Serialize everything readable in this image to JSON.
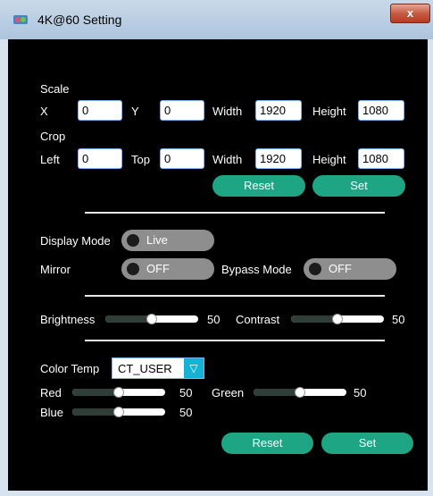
{
  "window": {
    "title": "4K@60 Setting",
    "close_label": "x"
  },
  "scale": {
    "heading": "Scale",
    "x_label": "X",
    "x_value": "0",
    "y_label": "Y",
    "y_value": "0",
    "width_label": "Width",
    "width_value": "1920",
    "height_label": "Height",
    "height_value": "1080"
  },
  "crop": {
    "heading": "Crop",
    "left_label": "Left",
    "left_value": "0",
    "top_label": "Top",
    "top_value": "0",
    "width_label": "Width",
    "width_value": "1920",
    "height_label": "Height",
    "height_value": "1080",
    "reset_label": "Reset",
    "set_label": "Set"
  },
  "display": {
    "mode_label": "Display Mode",
    "mode_value": "Live",
    "mirror_label": "Mirror",
    "mirror_value": "OFF",
    "bypass_label": "Bypass Mode",
    "bypass_value": "OFF"
  },
  "picture": {
    "brightness_label": "Brightness",
    "brightness_value": "50",
    "brightness_level": 0.5,
    "contrast_label": "Contrast",
    "contrast_value": "50",
    "contrast_level": 0.5
  },
  "color": {
    "temp_label": "Color Temp",
    "temp_value": "CT_USER",
    "red_label": "Red",
    "red_value": "50",
    "red_level": 0.5,
    "green_label": "Green",
    "green_value": "50",
    "green_level": 0.5,
    "blue_label": "Blue",
    "blue_value": "50",
    "blue_level": 0.5,
    "reset_label": "Reset",
    "set_label": "Set"
  },
  "colors": {
    "accent": "#1da584",
    "dropdown": "#14b3d6",
    "background": "#000000",
    "toggle_off": "#8e8e8e"
  },
  "icons": {
    "app": "app-icon",
    "close": "close-icon",
    "dropdown": "chevron-down-icon"
  }
}
